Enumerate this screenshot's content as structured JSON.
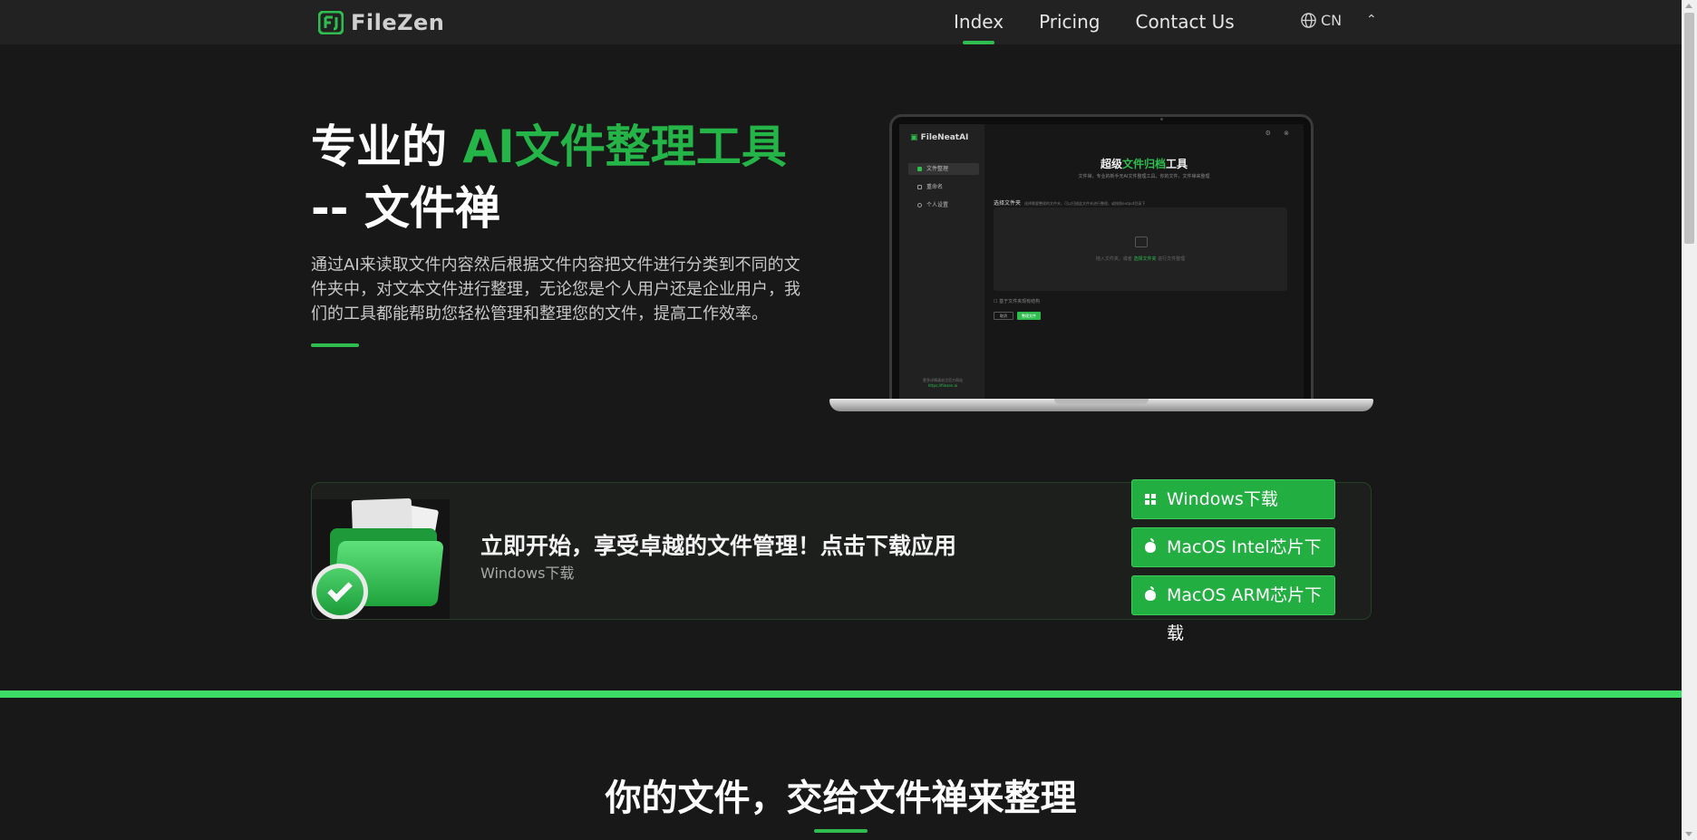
{
  "header": {
    "logo_text": "FileZen",
    "nav": [
      {
        "label": "Index",
        "active": true
      },
      {
        "label": "Pricing",
        "active": false
      },
      {
        "label": "Contact Us",
        "active": false
      }
    ],
    "language": "CN",
    "accent_color": "#2fbd4f"
  },
  "hero": {
    "title_prefix": "专业的 ",
    "title_highlight": "AI文件整理工具",
    "title_suffix": " -- 文件禅",
    "description": "通过AI来读取文件内容然后根据文件内容把文件进行分类到不同的文件夹中，对文本文件进行整理，无论您是个人用户还是企业用户，我们的工具都能帮助您轻松管理和整理您的文件，提高工作效率。"
  },
  "mockup": {
    "app_logo": "FileNeatAI",
    "menu": [
      "文件整理",
      "重命名",
      "个人设置"
    ],
    "title_prefix": "超级",
    "title_highlight": "文件归档",
    "title_suffix": "工具",
    "subtitle": "文件禅，专业的新手无AI文件整理工具，你的文件，文件禅来整理",
    "select_label": "选择文件夹",
    "select_hint": "选择需要整理的文件夹，可以扫描此文件夹进行整理，或按照output目录下",
    "drop_text_prefix": "拖入文件夹，或者 ",
    "drop_text_link": "选择文件夹",
    "drop_text_suffix": " 进行文件整理",
    "checkbox_label": "基于文件夹现有结构",
    "btn_cancel": "取消",
    "btn_start": "整理文件",
    "footer_text": "更多详情请关注官方网站",
    "footer_link": "https://filezen.ai"
  },
  "download": {
    "title": "立即开始，享受卓越的文件管理！点击下载应用",
    "subtitle": "Windows下载",
    "buttons": [
      {
        "label": "Windows下载",
        "icon": "windows-icon"
      },
      {
        "label": "MacOS Intel芯片下载",
        "icon": "apple-icon"
      },
      {
        "label": "MacOS ARM芯片下载",
        "icon": "apple-icon"
      }
    ]
  },
  "section": {
    "title": "你的文件，交给文件禅来整理"
  }
}
